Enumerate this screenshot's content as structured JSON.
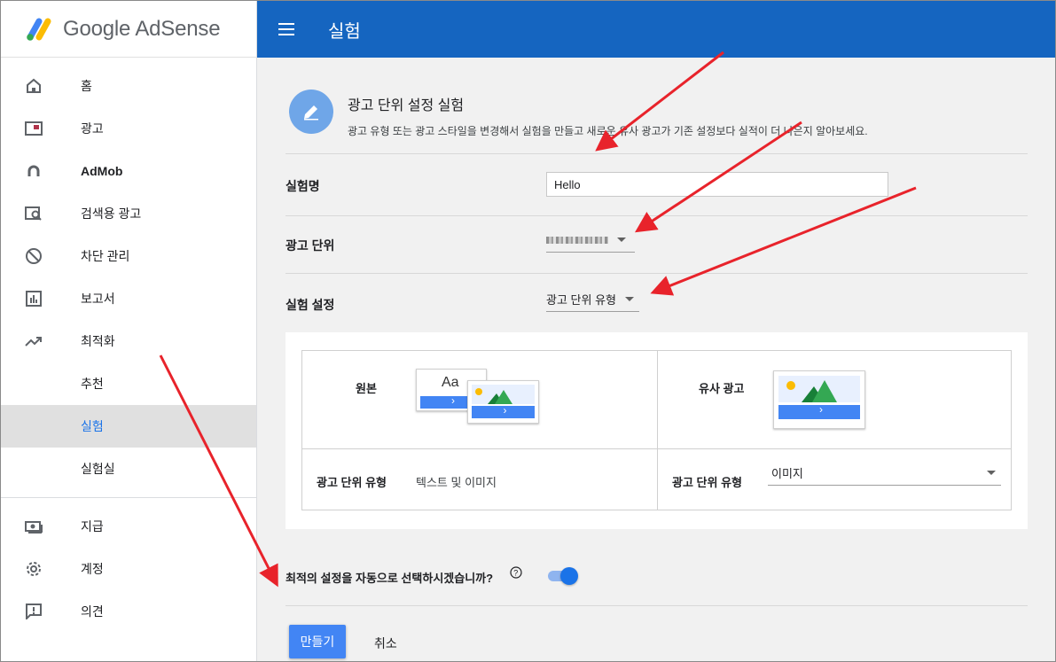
{
  "brand": {
    "name": "Google AdSense"
  },
  "sidebar": {
    "items": [
      {
        "label": "홈",
        "icon": "home-icon"
      },
      {
        "label": "광고",
        "icon": "ads-icon"
      },
      {
        "label": "AdMob",
        "icon": "admob-icon"
      },
      {
        "label": "검색용 광고",
        "icon": "search-ads-icon"
      },
      {
        "label": "차단 관리",
        "icon": "block-icon"
      },
      {
        "label": "보고서",
        "icon": "reports-icon"
      },
      {
        "label": "최적화",
        "icon": "optimization-icon"
      },
      {
        "label": "추천"
      },
      {
        "label": "실험"
      },
      {
        "label": "실험실"
      },
      {
        "label": "지급",
        "icon": "payments-icon"
      },
      {
        "label": "계정",
        "icon": "settings-icon"
      },
      {
        "label": "의견",
        "icon": "feedback-icon"
      }
    ],
    "active_label": "실험"
  },
  "header": {
    "title": "실험"
  },
  "intro": {
    "title": "광고 단위 설정 실험",
    "description": "광고 유형 또는 광고 스타일을 변경해서 실험을 만들고 새로운 유사 광고가 기존 설정보다 실적이 더 나은지 알아보세요."
  },
  "form": {
    "experiment_name": {
      "label": "실험명",
      "value": "Hello"
    },
    "ad_unit": {
      "label": "광고 단위"
    },
    "experiment_setting": {
      "label": "실험 설정",
      "value": "광고 단위 유형"
    }
  },
  "comparison": {
    "original": {
      "title": "원본",
      "thumb_text": "Aa",
      "type_label": "광고 단위 유형",
      "type_value": "텍스트 및 이미지"
    },
    "variant": {
      "title": "유사 광고",
      "type_label": "광고 단위 유형",
      "type_value": "이미지"
    }
  },
  "auto_select": {
    "question": "최적의 설정을 자동으로 선택하시겠습니까?",
    "enabled": true
  },
  "actions": {
    "create": "만들기",
    "cancel": "취소"
  },
  "colors": {
    "header": "#1565c0",
    "primary": "#4285f4",
    "annotation_arrow": "#e8232b"
  }
}
